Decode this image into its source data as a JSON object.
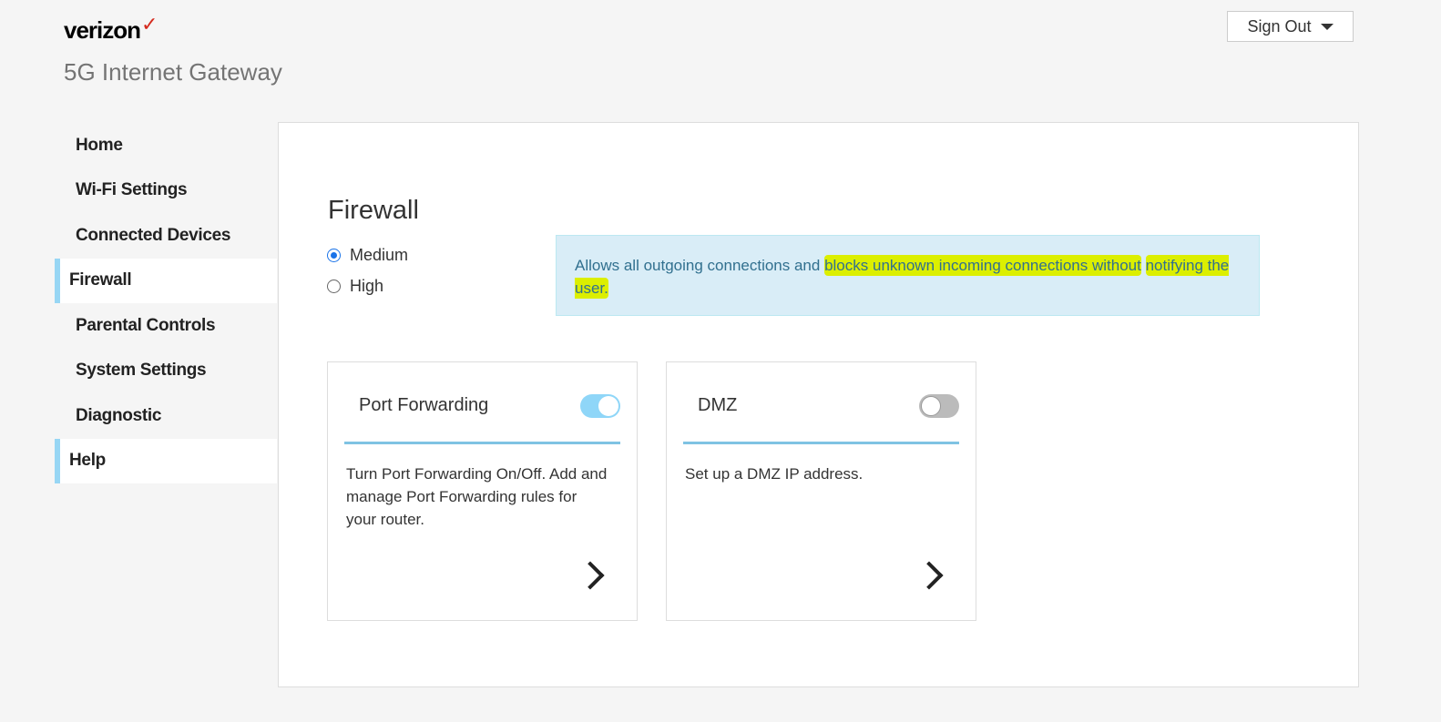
{
  "header": {
    "logo": "verizon",
    "subtitle": "5G Internet Gateway",
    "sign_out": "Sign Out"
  },
  "sidebar": {
    "items": [
      {
        "label": "Home"
      },
      {
        "label": "Wi-Fi Settings"
      },
      {
        "label": "Connected Devices"
      },
      {
        "label": "Firewall",
        "active": true
      },
      {
        "label": "Parental Controls"
      },
      {
        "label": "System Settings"
      },
      {
        "label": "Diagnostic"
      },
      {
        "label": "Help",
        "active": true
      }
    ]
  },
  "main": {
    "title": "Firewall",
    "options": [
      {
        "label": "Medium",
        "selected": true
      },
      {
        "label": "High",
        "selected": false
      }
    ],
    "info": {
      "text_plain": "Allows all outgoing connections and ",
      "text_highlight1": "blocks unknown incoming connections without",
      "text_highlight2": "notifying the user."
    },
    "cards": [
      {
        "title": "Port Forwarding",
        "enabled": true,
        "description": "Turn Port Forwarding On/Off. Add and manage Port Forwarding rules for your router."
      },
      {
        "title": "DMZ",
        "enabled": false,
        "description": "Set up a DMZ IP address."
      }
    ]
  },
  "colors": {
    "accent": "#97d6f4",
    "info_bg": "#d9edf7",
    "highlight": "#dcef00",
    "brand_check": "#d52b1e"
  }
}
